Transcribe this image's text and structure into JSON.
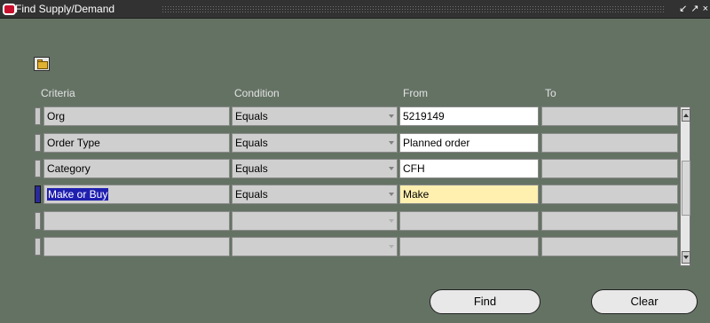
{
  "window": {
    "title": "Find Supply/Demand",
    "title_icon": "oracle-logo-icon",
    "controls": [
      "↙",
      "↗",
      "×"
    ]
  },
  "toolbar": {
    "folder_icon": "open-folder-icon"
  },
  "columns": {
    "criteria": "Criteria",
    "condition": "Condition",
    "from": "From",
    "to": "To"
  },
  "rows": [
    {
      "criteria": "Org",
      "condition": "Equals",
      "from": "5219149",
      "to": ""
    },
    {
      "criteria": "Order Type",
      "condition": "Equals",
      "from": "Planned order",
      "to": ""
    },
    {
      "criteria": "Category",
      "condition": "Equals",
      "from": "CFH",
      "to": ""
    },
    {
      "criteria": "Make or Buy",
      "condition": "Equals",
      "from": "Make",
      "to": ""
    },
    {
      "criteria": "",
      "condition": "",
      "from": "",
      "to": ""
    },
    {
      "criteria": "",
      "condition": "",
      "from": "",
      "to": ""
    }
  ],
  "buttons": {
    "find": "Find",
    "clear": "Clear"
  },
  "colors": {
    "window_bg": "#647264",
    "titlebar": "#323232",
    "selection": "#1f1fb0",
    "active_field": "#fff0b0"
  }
}
